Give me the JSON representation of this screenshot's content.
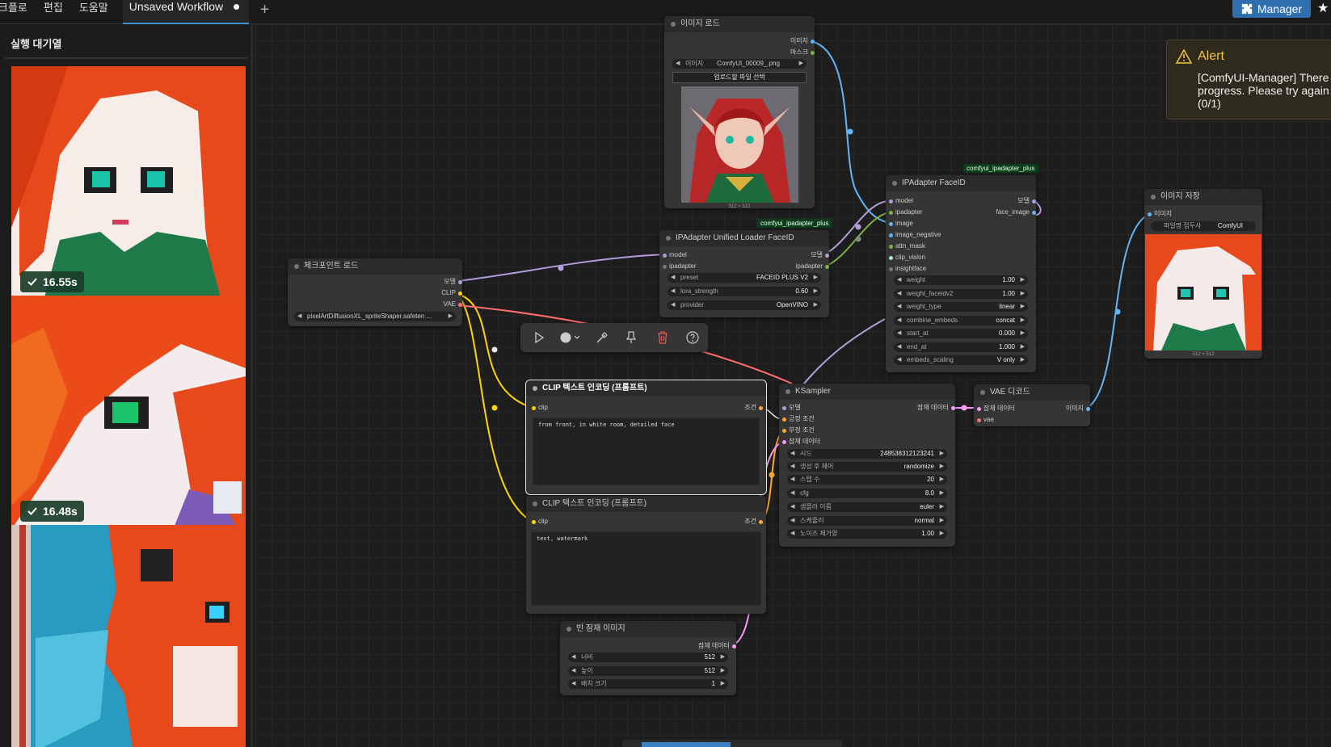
{
  "menu": [
    "크플로",
    "편집",
    "도움말"
  ],
  "workflow_tab": {
    "label": "Unsaved Workflow"
  },
  "manager_button": {
    "label": "Manager"
  },
  "queue": {
    "title": "실행 대기열",
    "items": [
      {
        "time": "16.55s"
      },
      {
        "time": "16.48s"
      },
      {
        "time": ""
      }
    ]
  },
  "alert": {
    "title": "Alert",
    "message_lines": [
      "[ComfyUI-Manager] There",
      "progress. Please try again",
      "(0/1)"
    ]
  },
  "colors": {
    "model": "#b39ddb",
    "clip": "#ffd500",
    "vae": "#ff6e6e",
    "image": "#64b5f6",
    "latent": "#ff9cf9",
    "conditioning": "#ffa931",
    "ipadapter": "#7cb342",
    "other": "#888888"
  },
  "nodes": {
    "load_image": {
      "title": "이미지 로드",
      "outputs": [
        "이미지",
        "마스크"
      ],
      "image_widget": {
        "name": "이미지",
        "value": "ComfyUI_00009_.png"
      },
      "upload_button": "업로드할 파일 선택",
      "size": "512 × 512"
    },
    "checkpoint": {
      "title": "체크포인트 로드",
      "outputs": [
        "모델",
        "CLIP",
        "VAE"
      ],
      "ckpt": "pixelArtDiffusionXL_spriteShaper.safeten ..."
    },
    "ipa_loader": {
      "badge": "comfyui_ipadapter_plus",
      "title": "IPAdapter Unified Loader FaceID",
      "inputs": [
        "model",
        "ipadapter"
      ],
      "outputs": [
        "모델",
        "ipadapter"
      ],
      "widgets": [
        {
          "name": "preset",
          "value": "FACEID PLUS V2"
        },
        {
          "name": "lora_strength",
          "value": "0.60"
        },
        {
          "name": "provider",
          "value": "OpenVINO"
        }
      ]
    },
    "ipa_faceid": {
      "badge": "comfyui_ipadapter_plus",
      "title": "IPAdapter FaceID",
      "inputs": [
        "model",
        "ipadapter",
        "image",
        "image_negative",
        "attn_mask",
        "clip_vision",
        "insightface"
      ],
      "outputs": [
        "모델",
        "face_image"
      ],
      "widgets": [
        {
          "name": "weight",
          "value": "1.00"
        },
        {
          "name": "weight_faceidv2",
          "value": "1.00"
        },
        {
          "name": "weight_type",
          "value": "linear"
        },
        {
          "name": "combine_embeds",
          "value": "concat"
        },
        {
          "name": "start_at",
          "value": "0.000"
        },
        {
          "name": "end_at",
          "value": "1.000"
        },
        {
          "name": "embeds_scaling",
          "value": "V only"
        }
      ]
    },
    "save_image": {
      "title": "이미지 저장",
      "input": "이미지",
      "widget": {
        "name": "파일명 접두사",
        "value": "ComfyUI"
      },
      "size": "512 × 512"
    },
    "clip_pos": {
      "title": "CLIP 텍스트 인코딩 (프롬프트)",
      "input": "clip",
      "output": "조건",
      "text": "from front, in white room, detailed face"
    },
    "clip_neg": {
      "title": "CLIP 텍스트 인코딩 (프롬프트)",
      "input": "clip",
      "output": "조건",
      "text": "text, watermark"
    },
    "ksampler": {
      "title": "KSampler",
      "inputs": [
        "모델",
        "긍정 조건",
        "부정 조건",
        "잠재 데이터"
      ],
      "output": "잠재 데이터",
      "widgets": [
        {
          "name": "시드",
          "value": "248538312123241"
        },
        {
          "name": "생성 후 제어",
          "value": "randomize"
        },
        {
          "name": "스텝 수",
          "value": "20"
        },
        {
          "name": "cfg",
          "value": "8.0"
        },
        {
          "name": "샘플러 이름",
          "value": "euler"
        },
        {
          "name": "스케줄러",
          "value": "normal"
        },
        {
          "name": "노이즈 제거양",
          "value": "1.00"
        }
      ]
    },
    "vae_decode": {
      "title": "VAE 디코드",
      "inputs": [
        "잠재 데이터",
        "vae"
      ],
      "output": "이미지"
    },
    "empty_latent": {
      "title": "빈 잠재 이미지",
      "output": "잠재 데이터",
      "widgets": [
        {
          "name": "너비",
          "value": "512"
        },
        {
          "name": "높이",
          "value": "512"
        },
        {
          "name": "배치 크기",
          "value": "1"
        }
      ]
    }
  }
}
